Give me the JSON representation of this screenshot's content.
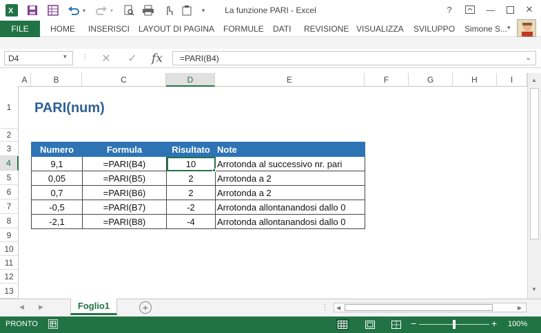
{
  "window": {
    "title": "La funzione PARI - Excel",
    "help": "?",
    "minimize": "—",
    "close": "✕"
  },
  "ribbon": {
    "file": "FILE",
    "tabs": [
      "HOME",
      "INSERISCI",
      "LAYOUT DI PAGINA",
      "FORMULE",
      "DATI",
      "REVISIONE",
      "VISUALIZZA",
      "SVILUPPO"
    ],
    "user": "Simone S..."
  },
  "formula_bar": {
    "name_box": "D4",
    "formula": "=PARI(B4)",
    "fx": "fx"
  },
  "columns": [
    "A",
    "B",
    "C",
    "D",
    "E",
    "F",
    "G",
    "H",
    "I"
  ],
  "active_column": "D",
  "rows": [
    "1",
    "2",
    "3",
    "4",
    "5",
    "6",
    "7",
    "8",
    "9",
    "10",
    "11",
    "12",
    "13"
  ],
  "active_row": "4",
  "sheet": {
    "title": "PARI(num)",
    "headers": [
      "Numero",
      "Formula",
      "Risultato",
      "Note"
    ],
    "data": [
      [
        "9,1",
        "=PARI(B4)",
        "10",
        "Arrotonda al successivo nr. pari"
      ],
      [
        "0,05",
        "=PARI(B5)",
        "2",
        "Arrotonda a 2"
      ],
      [
        "0,7",
        "=PARI(B6)",
        "2",
        "Arrotonda a 2"
      ],
      [
        "-0,5",
        "=PARI(B7)",
        "-2",
        "Arrotonda allontanandosi dallo 0"
      ],
      [
        "-2,1",
        "=PARI(B8)",
        "-4",
        "Arrotonda allontanandosi dallo 0"
      ]
    ]
  },
  "tabs": {
    "sheet_name": "Foglio1",
    "add": "+"
  },
  "status": {
    "text": "PRONTO",
    "zoom": "100%",
    "zoom_minus": "−",
    "zoom_plus": "+"
  },
  "colors": {
    "excel_green": "#217346",
    "table_header": "#2e74b5",
    "title_blue": "#2e5f96"
  }
}
